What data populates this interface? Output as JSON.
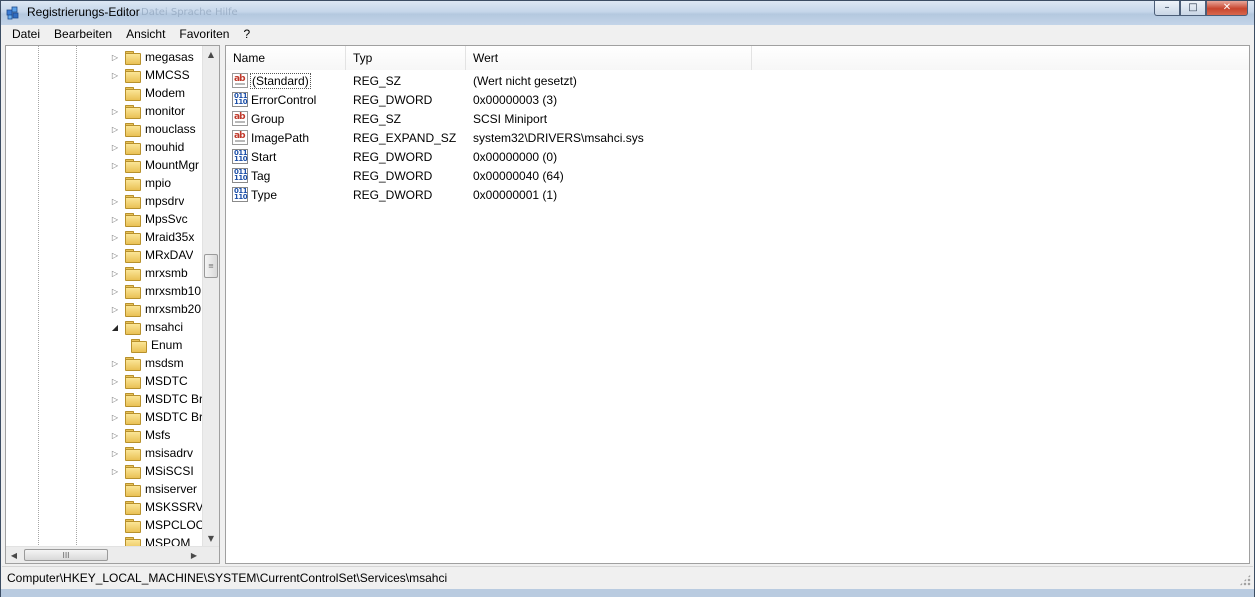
{
  "window": {
    "title": "Registrierungs-Editor",
    "ghost_menu": [
      "Datei",
      "Sprache",
      "Hilfe"
    ],
    "buttons": {
      "minimize": "–",
      "maximize": "□",
      "close": "✕"
    }
  },
  "menu": [
    "Datei",
    "Bearbeiten",
    "Ansicht",
    "Favoriten",
    "?"
  ],
  "tree": {
    "items": [
      {
        "label": "megasas",
        "expander": "collapsed"
      },
      {
        "label": "MMCSS",
        "expander": "collapsed"
      },
      {
        "label": "Modem",
        "expander": "none"
      },
      {
        "label": "monitor",
        "expander": "collapsed"
      },
      {
        "label": "mouclass",
        "expander": "collapsed"
      },
      {
        "label": "mouhid",
        "expander": "collapsed"
      },
      {
        "label": "MountMgr",
        "expander": "collapsed"
      },
      {
        "label": "mpio",
        "expander": "none"
      },
      {
        "label": "mpsdrv",
        "expander": "collapsed"
      },
      {
        "label": "MpsSvc",
        "expander": "collapsed"
      },
      {
        "label": "Mraid35x",
        "expander": "collapsed"
      },
      {
        "label": "MRxDAV",
        "expander": "collapsed"
      },
      {
        "label": "mrxsmb",
        "expander": "collapsed"
      },
      {
        "label": "mrxsmb10",
        "expander": "collapsed"
      },
      {
        "label": "mrxsmb20",
        "expander": "collapsed"
      },
      {
        "label": "msahci",
        "expander": "expanded"
      },
      {
        "label": "Enum",
        "expander": "none",
        "child": true
      },
      {
        "label": "msdsm",
        "expander": "collapsed"
      },
      {
        "label": "MSDTC",
        "expander": "collapsed"
      },
      {
        "label": "MSDTC Bri",
        "expander": "collapsed"
      },
      {
        "label": "MSDTC Bri",
        "expander": "collapsed"
      },
      {
        "label": "Msfs",
        "expander": "collapsed"
      },
      {
        "label": "msisadrv",
        "expander": "collapsed"
      },
      {
        "label": "MSiSCSI",
        "expander": "collapsed"
      },
      {
        "label": "msiserver",
        "expander": "none"
      },
      {
        "label": "MSKSSRV",
        "expander": "none"
      },
      {
        "label": "MSPCLOCK",
        "expander": "none"
      },
      {
        "label": "MSPOM",
        "expander": "none"
      }
    ],
    "scroll_up": "▲",
    "scroll_down": "▼",
    "scroll_left": "◀",
    "scroll_right": "▶",
    "thumb_grip": "≡",
    "hthumb_grip": "III"
  },
  "list": {
    "columns": [
      "Name",
      "Typ",
      "Wert"
    ],
    "rows": [
      {
        "name": "(Standard)",
        "type": "REG_SZ",
        "data": "(Wert nicht gesetzt)",
        "icon": "string",
        "selected": true
      },
      {
        "name": "ErrorControl",
        "type": "REG_DWORD",
        "data": "0x00000003 (3)",
        "icon": "dword"
      },
      {
        "name": "Group",
        "type": "REG_SZ",
        "data": "SCSI Miniport",
        "icon": "string"
      },
      {
        "name": "ImagePath",
        "type": "REG_EXPAND_SZ",
        "data": "system32\\DRIVERS\\msahci.sys",
        "icon": "string"
      },
      {
        "name": "Start",
        "type": "REG_DWORD",
        "data": "0x00000000 (0)",
        "icon": "dword"
      },
      {
        "name": "Tag",
        "type": "REG_DWORD",
        "data": "0x00000040 (64)",
        "icon": "dword"
      },
      {
        "name": "Type",
        "type": "REG_DWORD",
        "data": "0x00000001 (1)",
        "icon": "dword"
      }
    ],
    "string_icon_text": "ab",
    "dword_icon_text": "011\n110"
  },
  "status": {
    "path": "Computer\\HKEY_LOCAL_MACHINE\\SYSTEM\\CurrentControlSet\\Services\\msahci"
  },
  "colors": {
    "titlebar": "#c5d6ea",
    "close_button": "#c7452e",
    "folder": "#e9c155"
  }
}
